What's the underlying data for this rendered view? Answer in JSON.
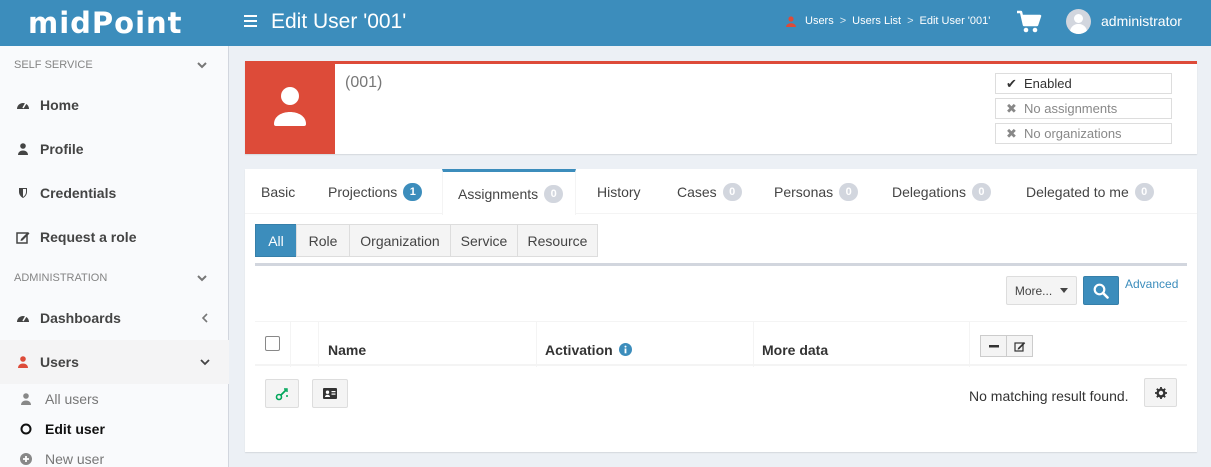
{
  "app": {
    "logo": "midPoint",
    "page_title": "Edit User '001'"
  },
  "breadcrumb": [
    "Users",
    "Users List",
    "Edit User '001'"
  ],
  "user_menu": {
    "name": "administrator"
  },
  "sidebar": {
    "self_service_header": "SELF SERVICE",
    "self_service_items": [
      {
        "label": "Home",
        "icon": "dashboard-icon"
      },
      {
        "label": "Profile",
        "icon": "user-icon"
      },
      {
        "label": "Credentials",
        "icon": "shield-icon"
      },
      {
        "label": "Request a role",
        "icon": "edit-icon"
      }
    ],
    "admin_header": "ADMINISTRATION",
    "admin_items": [
      {
        "label": "Dashboards",
        "icon": "dashboard-icon"
      },
      {
        "label": "Users",
        "icon": "user-icon"
      }
    ],
    "users_subitems": [
      {
        "label": "All users",
        "icon": "user-icon"
      },
      {
        "label": "Edit user",
        "icon": "circle-icon"
      },
      {
        "label": "New user",
        "icon": "plus-circle-icon"
      }
    ]
  },
  "summary": {
    "user_id": "(001)",
    "tags": [
      {
        "label": "Enabled",
        "state": "check"
      },
      {
        "label": "No assignments",
        "state": "x"
      },
      {
        "label": "No organizations",
        "state": "x"
      }
    ]
  },
  "tabs": [
    {
      "label": "Basic",
      "badge": null
    },
    {
      "label": "Projections",
      "badge": "1"
    },
    {
      "label": "Assignments",
      "badge": "0"
    },
    {
      "label": "History",
      "badge": null
    },
    {
      "label": "Cases",
      "badge": "0"
    },
    {
      "label": "Personas",
      "badge": "0"
    },
    {
      "label": "Delegations",
      "badge": "0"
    },
    {
      "label": "Delegated to me",
      "badge": "0"
    }
  ],
  "filter_buttons": [
    "All",
    "Role",
    "Organization",
    "Service",
    "Resource"
  ],
  "toolbar": {
    "more_label": "More...",
    "advanced_label": "Advanced"
  },
  "table": {
    "columns": [
      "Name",
      "Activation",
      "More data"
    ],
    "empty_message": "No matching result found."
  },
  "colors": {
    "brand": "#3c8dbc",
    "danger": "#dd4b39",
    "success": "#00a65a"
  }
}
